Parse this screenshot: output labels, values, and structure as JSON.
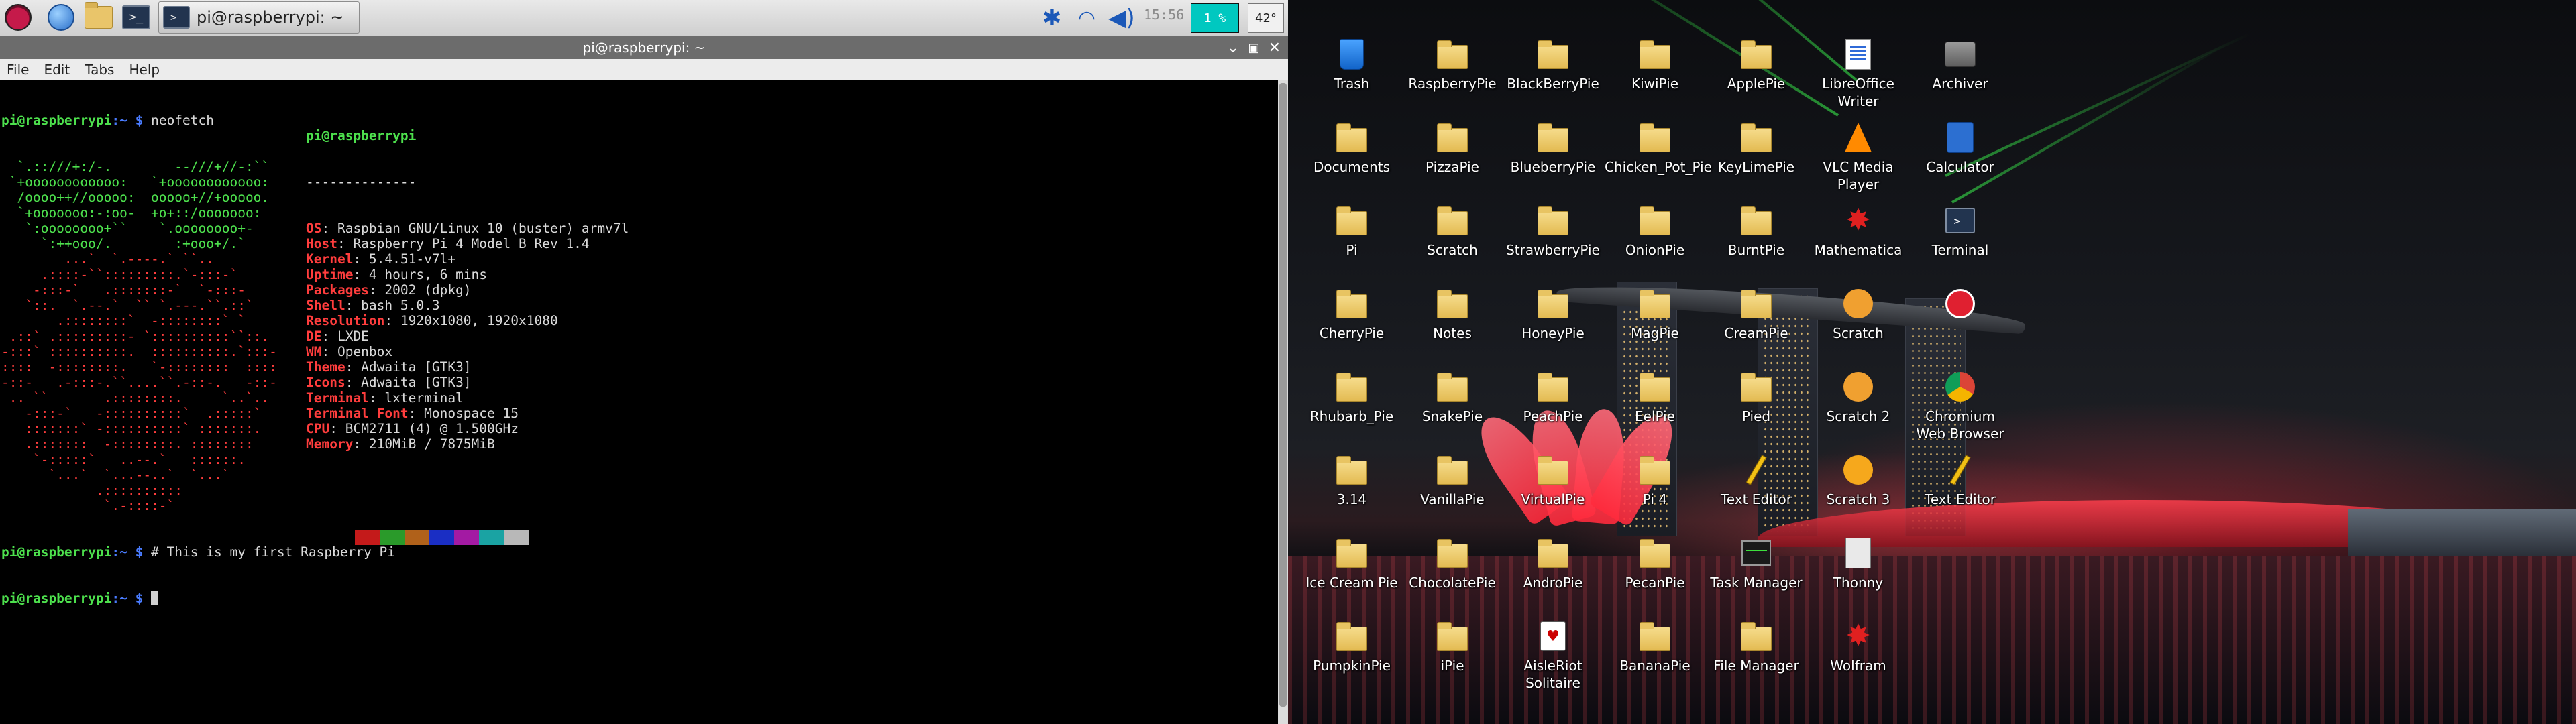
{
  "panel": {
    "task_title": "pi@raspberrypi: ~",
    "clock": "15:56",
    "cpu_usage": "1 %",
    "temperature": "42°",
    "tray_icons": [
      "bluetooth-icon",
      "wifi-icon",
      "volume-icon"
    ]
  },
  "window": {
    "title": "pi@raspberrypi: ~",
    "menu": [
      "File",
      "Edit",
      "Tabs",
      "Help"
    ]
  },
  "terminal": {
    "prompt_user": "pi@raspberrypi",
    "prompt_path": ":~ $",
    "cmd1": " neofetch",
    "header": "pi@raspberrypi",
    "rule": "--------------",
    "info": [
      {
        "k": "OS",
        "v": ": Raspbian GNU/Linux 10 (buster) armv7l"
      },
      {
        "k": "Host",
        "v": ": Raspberry Pi 4 Model B Rev 1.4"
      },
      {
        "k": "Kernel",
        "v": ": 5.4.51-v7l+"
      },
      {
        "k": "Uptime",
        "v": ": 4 hours, 6 mins"
      },
      {
        "k": "Packages",
        "v": ": 2002 (dpkg)"
      },
      {
        "k": "Shell",
        "v": ": bash 5.0.3"
      },
      {
        "k": "Resolution",
        "v": ": 1920x1080, 1920x1080"
      },
      {
        "k": "DE",
        "v": ": LXDE"
      },
      {
        "k": "WM",
        "v": ": Openbox"
      },
      {
        "k": "Theme",
        "v": ": Adwaita [GTK3]"
      },
      {
        "k": "Icons",
        "v": ": Adwaita [GTK3]"
      },
      {
        "k": "Terminal",
        "v": ": lxterminal"
      },
      {
        "k": "Terminal Font",
        "v": ": Monospace 15"
      },
      {
        "k": "CPU",
        "v": ": BCM2711 (4) @ 1.500GHz"
      },
      {
        "k": "Memory",
        "v": ": 210MiB / 7875MiB"
      }
    ],
    "palette": [
      "#000000",
      "#c41a1a",
      "#2a9a2a",
      "#b0611a",
      "#1a2ec4",
      "#a31aa3",
      "#1aa3a3",
      "#b8b8b8"
    ],
    "cmd2": " # This is my first Raspberry Pi",
    "cmd3": " ",
    "logo_green": [
      "  `.::///+:/-.        --///+//-:``",
      " `+oooooooooooo:   `+oooooooooooo:",
      "  /oooo++//ooooo:  ooooo+//+ooooo.",
      "  `+ooooooo:-:oo-  +o+::/ooooooo:",
      "   `:oooooooo+``    `.oooooooo+-",
      "     `:++ooo/.        :+ooo+/.`"
    ],
    "logo_red": [
      "        ...`  `.----.` ``..",
      "     .::::-``:::::::::.`-:::-`",
      "    -:::-`   .:::::::-`  `-:::-",
      "   `::.  `.--.`  `` `.---.``.::`",
      "       .::::::::`  -::::::::` `",
      " .::` .:::::::::- `::::::::::``::.",
      "-:::` ::::::::::.  ::::::::::.`:::-",
      "::::  -::::::::.   `-::::::::  ::::",
      "-::-   .-:::-.``....``.-::-.   -::-",
      " .. ``       .::::::::.     `..`..",
      "   -:::-`   -::::::::::`  .:::::`",
      "   :::::::` -::::::::::` :::::::.",
      "   .:::::::  -::::::::. ::::::::",
      "    `-:::::`   ..--.`   ::::::.",
      "      `...`  `...--..`  `...`",
      "            .::::::::::",
      "             `.-::::-`"
    ]
  },
  "desktop": {
    "icons": [
      {
        "label": "Trash",
        "kind": "trash"
      },
      {
        "label": "RaspberryPie",
        "kind": "folder"
      },
      {
        "label": "BlackBerryPie",
        "kind": "folder"
      },
      {
        "label": "KiwiPie",
        "kind": "folder"
      },
      {
        "label": "ApplePie",
        "kind": "folder"
      },
      {
        "label": "LibreOffice Writer",
        "kind": "doc"
      },
      {
        "label": "Archiver",
        "kind": "archiver"
      },
      {
        "label": "Documents",
        "kind": "folder"
      },
      {
        "label": "PizzaPie",
        "kind": "folder"
      },
      {
        "label": "BlueberryPie",
        "kind": "folder"
      },
      {
        "label": "Chicken_Pot_Pie",
        "kind": "folder"
      },
      {
        "label": "KeyLimePie",
        "kind": "folder"
      },
      {
        "label": "VLC Media Player",
        "kind": "vlc"
      },
      {
        "label": "Calculator",
        "kind": "calc"
      },
      {
        "label": "Pi",
        "kind": "folder"
      },
      {
        "label": "Scratch",
        "kind": "folder"
      },
      {
        "label": "StrawberryPie",
        "kind": "folder"
      },
      {
        "label": "OnionPie",
        "kind": "folder"
      },
      {
        "label": "BurntPie",
        "kind": "folder"
      },
      {
        "label": "Mathematica",
        "kind": "star"
      },
      {
        "label": "Terminal",
        "kind": "terminal"
      },
      {
        "label": "CherryPie",
        "kind": "folder"
      },
      {
        "label": "Notes",
        "kind": "folder"
      },
      {
        "label": "HoneyPie",
        "kind": "folder"
      },
      {
        "label": "MagPie",
        "kind": "folder"
      },
      {
        "label": "CreamPie",
        "kind": "folder"
      },
      {
        "label": "Scratch",
        "kind": "scratch"
      },
      {
        "label": "",
        "kind": "redround"
      },
      {
        "label": "Rhubarb_Pie",
        "kind": "folder"
      },
      {
        "label": "SnakePie",
        "kind": "folder"
      },
      {
        "label": "PeachPie",
        "kind": "folder"
      },
      {
        "label": "EelPie",
        "kind": "folder"
      },
      {
        "label": "Pied",
        "kind": "folder"
      },
      {
        "label": "Scratch 2",
        "kind": "scratch"
      },
      {
        "label": "Chromium Web Browser",
        "kind": "chromium"
      },
      {
        "label": "3.14",
        "kind": "folder"
      },
      {
        "label": "VanillaPie",
        "kind": "folder"
      },
      {
        "label": "VirtualPie",
        "kind": "folder"
      },
      {
        "label": "Pi 4",
        "kind": "folder"
      },
      {
        "label": "Text Editor",
        "kind": "pencil"
      },
      {
        "label": "Scratch 3",
        "kind": "scratch3"
      },
      {
        "label": "Text Editor",
        "kind": "pencil"
      },
      {
        "label": "Ice Cream Pie",
        "kind": "folder"
      },
      {
        "label": "ChocolatePie",
        "kind": "folder"
      },
      {
        "label": "AndroPie",
        "kind": "folder"
      },
      {
        "label": "PecanPie",
        "kind": "folder"
      },
      {
        "label": "Task Manager",
        "kind": "taskmgr"
      },
      {
        "label": "Thonny",
        "kind": "note"
      },
      {
        "label": "",
        "kind": "none"
      },
      {
        "label": "PumpkinPie",
        "kind": "folder"
      },
      {
        "label": "iPie",
        "kind": "folder"
      },
      {
        "label": "AisleRiot Solitaire",
        "kind": "cards"
      },
      {
        "label": "BananaPie",
        "kind": "folder"
      },
      {
        "label": "File Manager",
        "kind": "folder"
      },
      {
        "label": "Wolfram",
        "kind": "star"
      }
    ]
  }
}
